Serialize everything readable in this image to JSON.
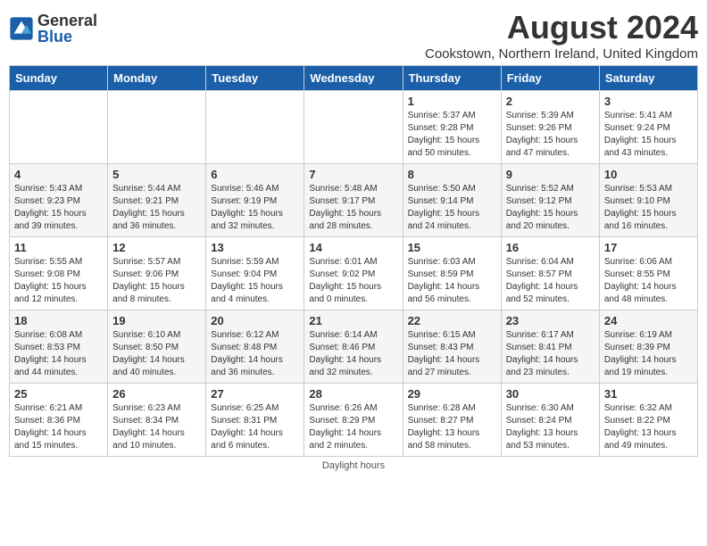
{
  "header": {
    "logo_general": "General",
    "logo_blue": "Blue",
    "month_year": "August 2024",
    "location": "Cookstown, Northern Ireland, United Kingdom"
  },
  "weekdays": [
    "Sunday",
    "Monday",
    "Tuesday",
    "Wednesday",
    "Thursday",
    "Friday",
    "Saturday"
  ],
  "weeks": [
    [
      {
        "day": "",
        "info": ""
      },
      {
        "day": "",
        "info": ""
      },
      {
        "day": "",
        "info": ""
      },
      {
        "day": "",
        "info": ""
      },
      {
        "day": "1",
        "info": "Sunrise: 5:37 AM\nSunset: 9:28 PM\nDaylight: 15 hours\nand 50 minutes."
      },
      {
        "day": "2",
        "info": "Sunrise: 5:39 AM\nSunset: 9:26 PM\nDaylight: 15 hours\nand 47 minutes."
      },
      {
        "day": "3",
        "info": "Sunrise: 5:41 AM\nSunset: 9:24 PM\nDaylight: 15 hours\nand 43 minutes."
      }
    ],
    [
      {
        "day": "4",
        "info": "Sunrise: 5:43 AM\nSunset: 9:23 PM\nDaylight: 15 hours\nand 39 minutes."
      },
      {
        "day": "5",
        "info": "Sunrise: 5:44 AM\nSunset: 9:21 PM\nDaylight: 15 hours\nand 36 minutes."
      },
      {
        "day": "6",
        "info": "Sunrise: 5:46 AM\nSunset: 9:19 PM\nDaylight: 15 hours\nand 32 minutes."
      },
      {
        "day": "7",
        "info": "Sunrise: 5:48 AM\nSunset: 9:17 PM\nDaylight: 15 hours\nand 28 minutes."
      },
      {
        "day": "8",
        "info": "Sunrise: 5:50 AM\nSunset: 9:14 PM\nDaylight: 15 hours\nand 24 minutes."
      },
      {
        "day": "9",
        "info": "Sunrise: 5:52 AM\nSunset: 9:12 PM\nDaylight: 15 hours\nand 20 minutes."
      },
      {
        "day": "10",
        "info": "Sunrise: 5:53 AM\nSunset: 9:10 PM\nDaylight: 15 hours\nand 16 minutes."
      }
    ],
    [
      {
        "day": "11",
        "info": "Sunrise: 5:55 AM\nSunset: 9:08 PM\nDaylight: 15 hours\nand 12 minutes."
      },
      {
        "day": "12",
        "info": "Sunrise: 5:57 AM\nSunset: 9:06 PM\nDaylight: 15 hours\nand 8 minutes."
      },
      {
        "day": "13",
        "info": "Sunrise: 5:59 AM\nSunset: 9:04 PM\nDaylight: 15 hours\nand 4 minutes."
      },
      {
        "day": "14",
        "info": "Sunrise: 6:01 AM\nSunset: 9:02 PM\nDaylight: 15 hours\nand 0 minutes."
      },
      {
        "day": "15",
        "info": "Sunrise: 6:03 AM\nSunset: 8:59 PM\nDaylight: 14 hours\nand 56 minutes."
      },
      {
        "day": "16",
        "info": "Sunrise: 6:04 AM\nSunset: 8:57 PM\nDaylight: 14 hours\nand 52 minutes."
      },
      {
        "day": "17",
        "info": "Sunrise: 6:06 AM\nSunset: 8:55 PM\nDaylight: 14 hours\nand 48 minutes."
      }
    ],
    [
      {
        "day": "18",
        "info": "Sunrise: 6:08 AM\nSunset: 8:53 PM\nDaylight: 14 hours\nand 44 minutes."
      },
      {
        "day": "19",
        "info": "Sunrise: 6:10 AM\nSunset: 8:50 PM\nDaylight: 14 hours\nand 40 minutes."
      },
      {
        "day": "20",
        "info": "Sunrise: 6:12 AM\nSunset: 8:48 PM\nDaylight: 14 hours\nand 36 minutes."
      },
      {
        "day": "21",
        "info": "Sunrise: 6:14 AM\nSunset: 8:46 PM\nDaylight: 14 hours\nand 32 minutes."
      },
      {
        "day": "22",
        "info": "Sunrise: 6:15 AM\nSunset: 8:43 PM\nDaylight: 14 hours\nand 27 minutes."
      },
      {
        "day": "23",
        "info": "Sunrise: 6:17 AM\nSunset: 8:41 PM\nDaylight: 14 hours\nand 23 minutes."
      },
      {
        "day": "24",
        "info": "Sunrise: 6:19 AM\nSunset: 8:39 PM\nDaylight: 14 hours\nand 19 minutes."
      }
    ],
    [
      {
        "day": "25",
        "info": "Sunrise: 6:21 AM\nSunset: 8:36 PM\nDaylight: 14 hours\nand 15 minutes."
      },
      {
        "day": "26",
        "info": "Sunrise: 6:23 AM\nSunset: 8:34 PM\nDaylight: 14 hours\nand 10 minutes."
      },
      {
        "day": "27",
        "info": "Sunrise: 6:25 AM\nSunset: 8:31 PM\nDaylight: 14 hours\nand 6 minutes."
      },
      {
        "day": "28",
        "info": "Sunrise: 6:26 AM\nSunset: 8:29 PM\nDaylight: 14 hours\nand 2 minutes."
      },
      {
        "day": "29",
        "info": "Sunrise: 6:28 AM\nSunset: 8:27 PM\nDaylight: 13 hours\nand 58 minutes."
      },
      {
        "day": "30",
        "info": "Sunrise: 6:30 AM\nSunset: 8:24 PM\nDaylight: 13 hours\nand 53 minutes."
      },
      {
        "day": "31",
        "info": "Sunrise: 6:32 AM\nSunset: 8:22 PM\nDaylight: 13 hours\nand 49 minutes."
      }
    ]
  ],
  "footer": {
    "note": "Daylight hours"
  }
}
